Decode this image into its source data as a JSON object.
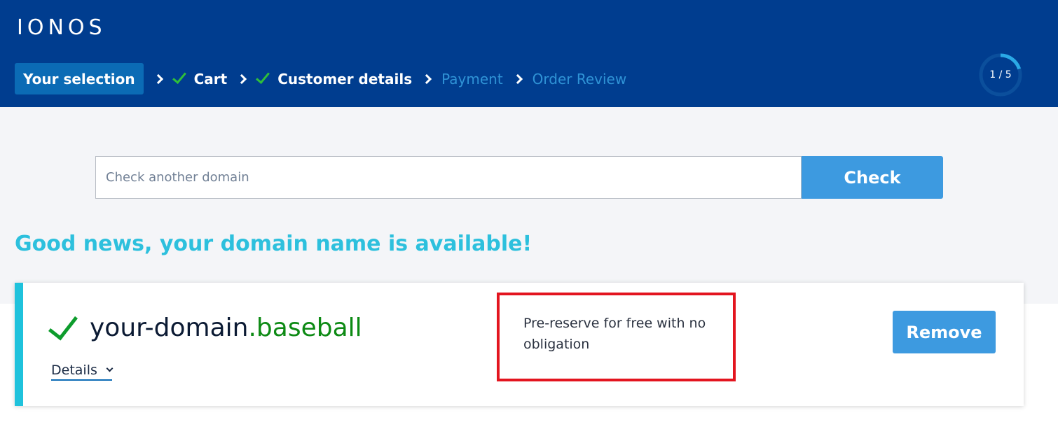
{
  "brand": {
    "logo_text": "IONOS"
  },
  "steps": [
    {
      "label": "Your selection",
      "state": "active"
    },
    {
      "label": "Cart",
      "state": "done"
    },
    {
      "label": "Customer details",
      "state": "done"
    },
    {
      "label": "Payment",
      "state": "upcoming"
    },
    {
      "label": "Order Review",
      "state": "upcoming"
    }
  ],
  "progress": {
    "label": "1 / 5",
    "fraction": 0.2
  },
  "search": {
    "placeholder": "Check another domain",
    "button_label": "Check"
  },
  "result": {
    "headline": "Good news, your domain name is available!",
    "domain_name": "your-domain",
    "domain_tld": ".baseball",
    "details_label": "Details",
    "note": "Pre-reserve for free with no obligation",
    "remove_label": "Remove"
  },
  "colors": {
    "header_bg": "#003d8f",
    "accent_blue": "#3d9ae0",
    "headline": "#2dc0dd",
    "success_green": "#0d9c2c",
    "highlight_red": "#e3151f"
  },
  "icons": [
    "chevron-right-icon",
    "checkmark-icon",
    "chevron-down-icon"
  ]
}
